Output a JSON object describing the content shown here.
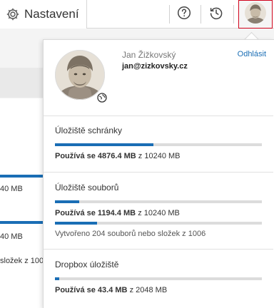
{
  "header": {
    "tab_label": "Nastavení",
    "icons": [
      "gear-icon",
      "help-icon",
      "history-icon",
      "user-avatar"
    ]
  },
  "background": {
    "row1": "40 MB",
    "row2": "40 MB",
    "row3": "složek z 100"
  },
  "user": {
    "name": "Jan Žižkovský",
    "email": "jan@zizkovsky.cz",
    "logout_label": "Odhlásit"
  },
  "storage": [
    {
      "title": "Úložiště schránky",
      "used_label": "Používá se",
      "used": "4876.4 MB",
      "of_label": "z",
      "total": "10240 MB",
      "fraction": 0.476
    },
    {
      "title": "Úložiště souborů",
      "used_label": "Používá se",
      "used": "1194.4 MB",
      "of_label": "z",
      "total": "10240 MB",
      "fraction": 0.117,
      "note": "Vytvořeno 204 souborů nebo složek z 1006",
      "note_fraction": 0.203
    },
    {
      "title": "Dropbox úložiště",
      "used_label": "Používá se",
      "used": "43.4 MB",
      "of_label": "z",
      "total": "2048 MB",
      "fraction": 0.021
    }
  ],
  "colors": {
    "accent": "#1a6eb5",
    "track": "#dcdcdc",
    "active_border": "#d0021b"
  }
}
